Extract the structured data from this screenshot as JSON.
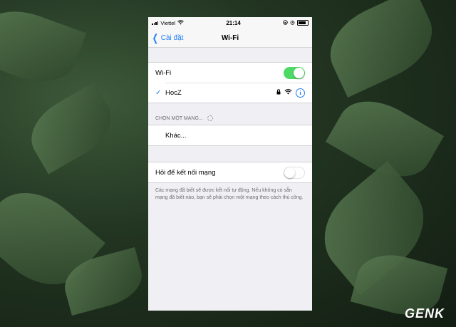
{
  "status_bar": {
    "carrier": "Viettel",
    "time": "21:14"
  },
  "nav": {
    "back_label": "Cài đặt",
    "title": "Wi-Fi"
  },
  "wifi": {
    "label": "Wi-Fi",
    "enabled": true
  },
  "connected_network": {
    "name": "HocZ",
    "secured": true
  },
  "choose_network": {
    "header": "CHỌN MỘT MẠNG...",
    "other_label": "Khác..."
  },
  "ask_to_join": {
    "label": "Hỏi để kết nối mạng",
    "enabled": false,
    "description": "Các mạng đã biết sẽ được kết nối tự động. Nếu không có sẵn mạng đã biết nào, bạn sẽ phải chọn một mạng theo cách thủ công."
  },
  "watermark": "GENK",
  "colors": {
    "accent": "#1f7cf5",
    "toggle_on": "#4cd964",
    "background": "#efeff4"
  }
}
